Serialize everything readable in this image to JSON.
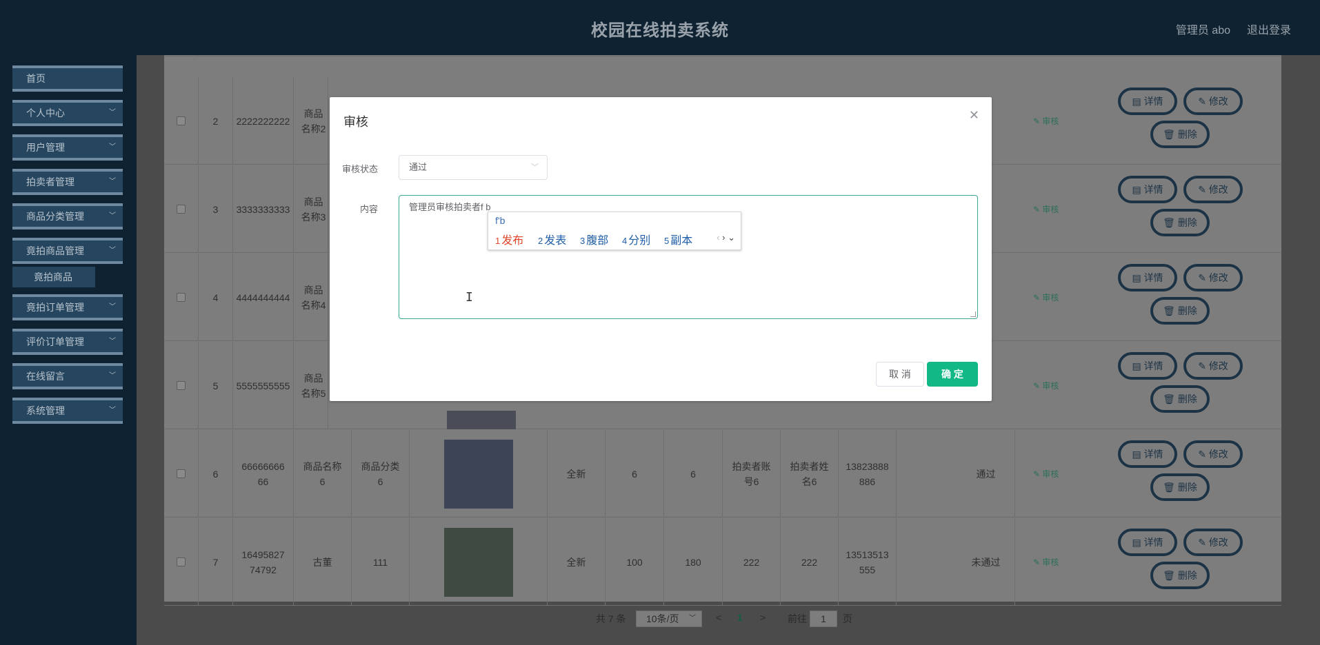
{
  "header": {
    "title": "校园在线拍卖系统",
    "admin": "管理员 abo",
    "logout": "退出登录"
  },
  "sidebar": {
    "items": [
      {
        "label": "首页",
        "has_children": false
      },
      {
        "label": "个人中心",
        "has_children": true
      },
      {
        "label": "用户管理",
        "has_children": true
      },
      {
        "label": "拍卖者管理",
        "has_children": true
      },
      {
        "label": "商品分类管理",
        "has_children": true
      },
      {
        "label": "竟拍商品管理",
        "has_children": true
      },
      {
        "label": "竟拍订单管理",
        "has_children": true
      },
      {
        "label": "评价订单管理",
        "has_children": true
      },
      {
        "label": "在线留言",
        "has_children": true
      },
      {
        "label": "系统管理",
        "has_children": true
      }
    ],
    "subitem": "竟拍商品"
  },
  "table": {
    "rows": [
      {
        "idx": "2",
        "code": "2222222222",
        "name": "商品名称2",
        "category": "",
        "condition": "",
        "price": "",
        "bid": "",
        "account": "",
        "seller": "",
        "phone": "",
        "status": "",
        "audit": "审核"
      },
      {
        "idx": "3",
        "code": "3333333333",
        "name": "商品名称3",
        "category": "",
        "condition": "",
        "price": "",
        "bid": "",
        "account": "",
        "seller": "",
        "phone": "",
        "status": "",
        "audit": "审核"
      },
      {
        "idx": "4",
        "code": "4444444444",
        "name": "商品名称4",
        "category": "",
        "condition": "",
        "price": "",
        "bid": "",
        "account": "",
        "seller": "",
        "phone": "",
        "status": "",
        "audit": "审核"
      },
      {
        "idx": "5",
        "code": "5555555555",
        "name": "商品名称5",
        "category": "",
        "condition": "",
        "price": "",
        "bid": "",
        "account": "",
        "seller": "",
        "phone": "",
        "status": "",
        "audit": "审核"
      },
      {
        "idx": "6",
        "code": "6666666666",
        "name": "商品名称6",
        "category": "商品分类6",
        "condition": "全新",
        "price": "6",
        "bid": "6",
        "account": "拍卖者账号6",
        "seller": "拍卖者姓名6",
        "phone": "13823888886",
        "status": "通过",
        "audit": "审核"
      },
      {
        "idx": "7",
        "code": "1649582774792",
        "name": "古董",
        "category": "111",
        "condition": "全新",
        "price": "100",
        "bid": "180",
        "account": "222",
        "seller": "222",
        "phone": "13513513555",
        "status": "未通过",
        "audit": "审核"
      }
    ],
    "actions": {
      "detail": "详情",
      "edit": "修改",
      "delete": "删除"
    }
  },
  "pagination": {
    "total": "共 7 条",
    "page_size": "10条/页",
    "current": "1",
    "goto_prefix": "前往",
    "goto_value": "1",
    "goto_suffix": "页"
  },
  "dialog": {
    "title": "审核",
    "status_label": "审核状态",
    "status_value": "通过",
    "content_label": "内容",
    "content_value": "管理员审核拍卖者f b",
    "cancel": "取 消",
    "confirm": "确 定",
    "ime": {
      "composition": "f'b",
      "candidates": [
        {
          "num": "1",
          "text": "发布"
        },
        {
          "num": "2",
          "text": "发表"
        },
        {
          "num": "3",
          "text": "腹部"
        },
        {
          "num": "4",
          "text": "分别"
        },
        {
          "num": "5",
          "text": "副本"
        }
      ]
    }
  }
}
